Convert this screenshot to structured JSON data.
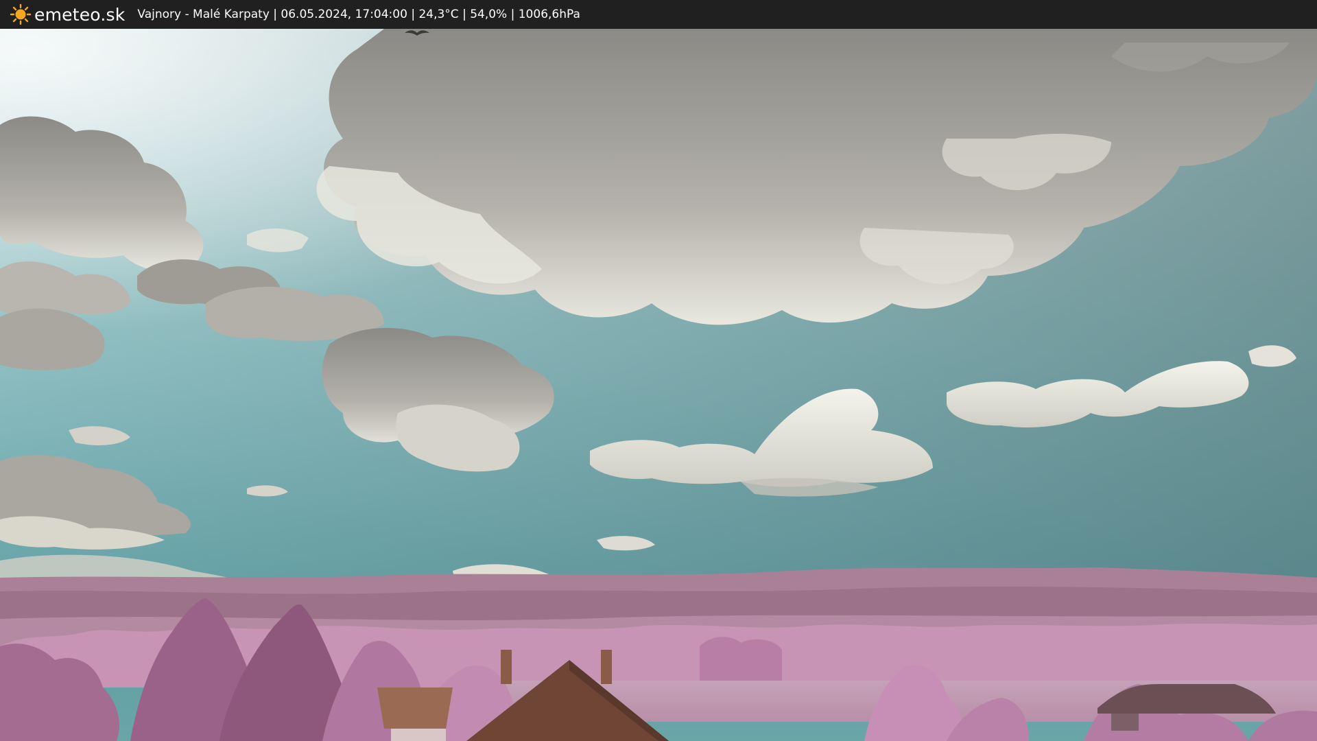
{
  "header": {
    "brand": "emeteo.sk",
    "caption": "Vajnory - Malé Karpaty | 06.05.2024, 17:04:00 | 24,3°C | 54,0% | 1006,6hPa"
  },
  "icons": {
    "logo": "sun-icon"
  },
  "colors": {
    "bar": "#202020",
    "sun": "#f5a623",
    "sky_top": "#b9d4d6",
    "sky_bottom": "#6aa9ad",
    "hills": "#a27a93",
    "trees": "#b77fa5",
    "roof": "#7a5040"
  }
}
